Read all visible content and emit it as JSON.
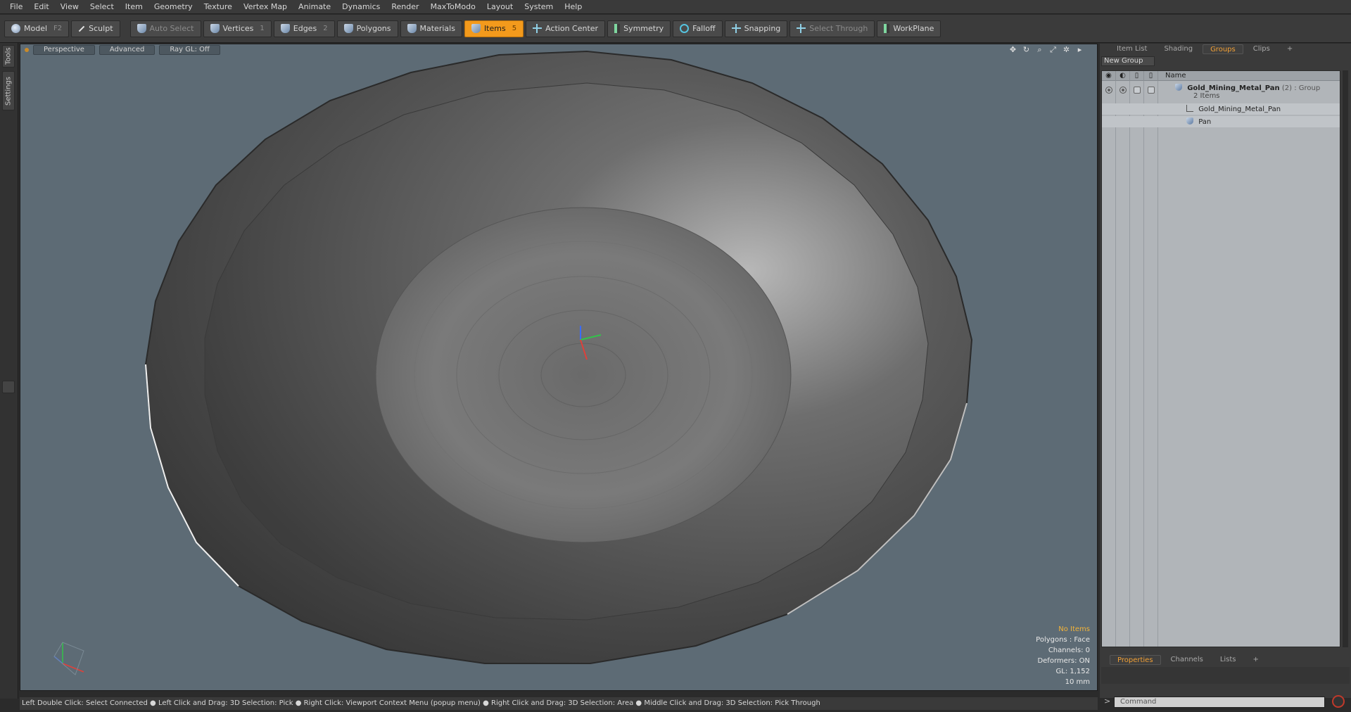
{
  "menu": [
    "File",
    "Edit",
    "View",
    "Select",
    "Item",
    "Geometry",
    "Texture",
    "Vertex Map",
    "Animate",
    "Dynamics",
    "Render",
    "MaxToModo",
    "Layout",
    "System",
    "Help"
  ],
  "toolbar": {
    "model": "Model",
    "model_key": "F2",
    "sculpt": "Sculpt",
    "auto_select": "Auto Select",
    "vertices": "Vertices",
    "vertices_key": "1",
    "edges": "Edges",
    "edges_key": "2",
    "polygons": "Polygons",
    "materials": "Materials",
    "items": "Items",
    "items_key": "5",
    "action_center": "Action Center",
    "symmetry": "Symmetry",
    "falloff": "Falloff",
    "snapping": "Snapping",
    "select_through": "Select Through",
    "workplane": "WorkPlane"
  },
  "left_tabs": {
    "tools": "Tools",
    "settings": "Settings"
  },
  "viewport": {
    "view": "Perspective",
    "advanced": "Advanced",
    "raygl": "Ray GL: Off",
    "info": {
      "selection": "No Items",
      "polygons": "Polygons : Face",
      "channels": "Channels: 0",
      "deformers": "Deformers: ON",
      "gl": "GL: 1,152",
      "scale": "10 mm"
    },
    "colors": {
      "background": "#5d6b75",
      "selected": "#f2b339"
    }
  },
  "statusbar": "Left Double Click: Select Connected ● Left Click and Drag: 3D Selection: Pick ● Right Click: Viewport Context Menu (popup menu) ● Right Click and Drag: 3D Selection: Area ● Middle Click and Drag: 3D Selection: Pick Through",
  "right_panel": {
    "tabs": [
      "Item List",
      "Shading",
      "Groups",
      "Clips",
      "+"
    ],
    "new_group": "New Group",
    "name_header": "Name",
    "tree": {
      "group_name": "Gold_Mining_Metal_Pan",
      "group_count": "(2)",
      "group_type": ": Group",
      "group_items": "2 Items",
      "child1": "Gold_Mining_Metal_Pan",
      "child2": "Pan"
    },
    "bottom_tabs": [
      "Properties",
      "Channels",
      "Lists",
      "+"
    ],
    "command_placeholder": "Command",
    "accent": "#f2a035"
  }
}
